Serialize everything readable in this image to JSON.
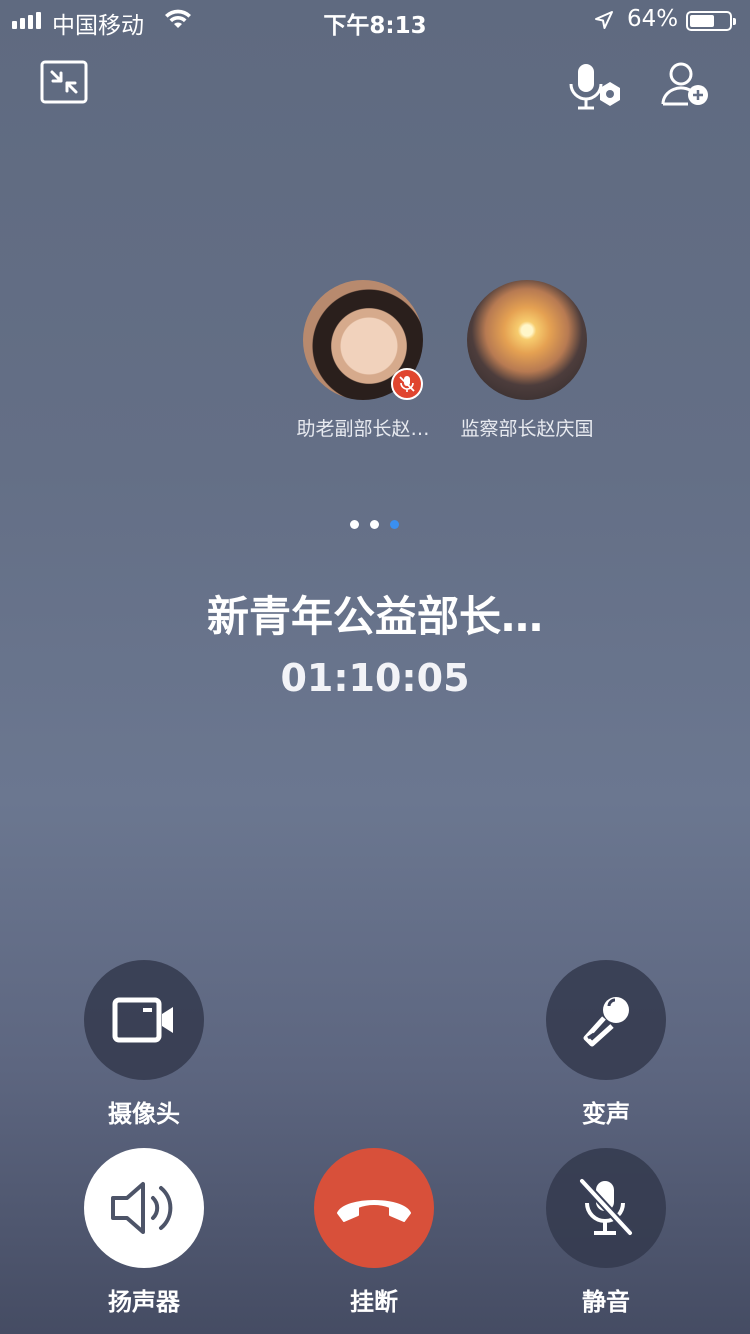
{
  "status_bar": {
    "carrier": "中国移动",
    "time": "下午8:13",
    "battery_percent": "64%",
    "battery_level": 0.64,
    "icons": [
      "signal-icon",
      "wifi-icon",
      "location-arrow-icon",
      "battery-icon"
    ]
  },
  "top_actions": {
    "icons": [
      "minimize-icon",
      "voice-settings-icon",
      "add-member-icon"
    ]
  },
  "participants": [
    {
      "name": "助老副部长赵…",
      "muted": true
    },
    {
      "name": "监察部长赵庆国",
      "muted": false
    }
  ],
  "pager": {
    "count": 3,
    "active_index": 2
  },
  "call": {
    "title": "新青年公益部长…",
    "duration": "01:10:05"
  },
  "controls": {
    "camera": "摄像头",
    "voice_change": "变声",
    "speaker": "扬声器",
    "hangup": "挂断",
    "mute": "静音"
  },
  "colors": {
    "hangup_red": "#d8503a",
    "mute_badge": "#e0452f",
    "active_dot": "#3a8ff0"
  }
}
